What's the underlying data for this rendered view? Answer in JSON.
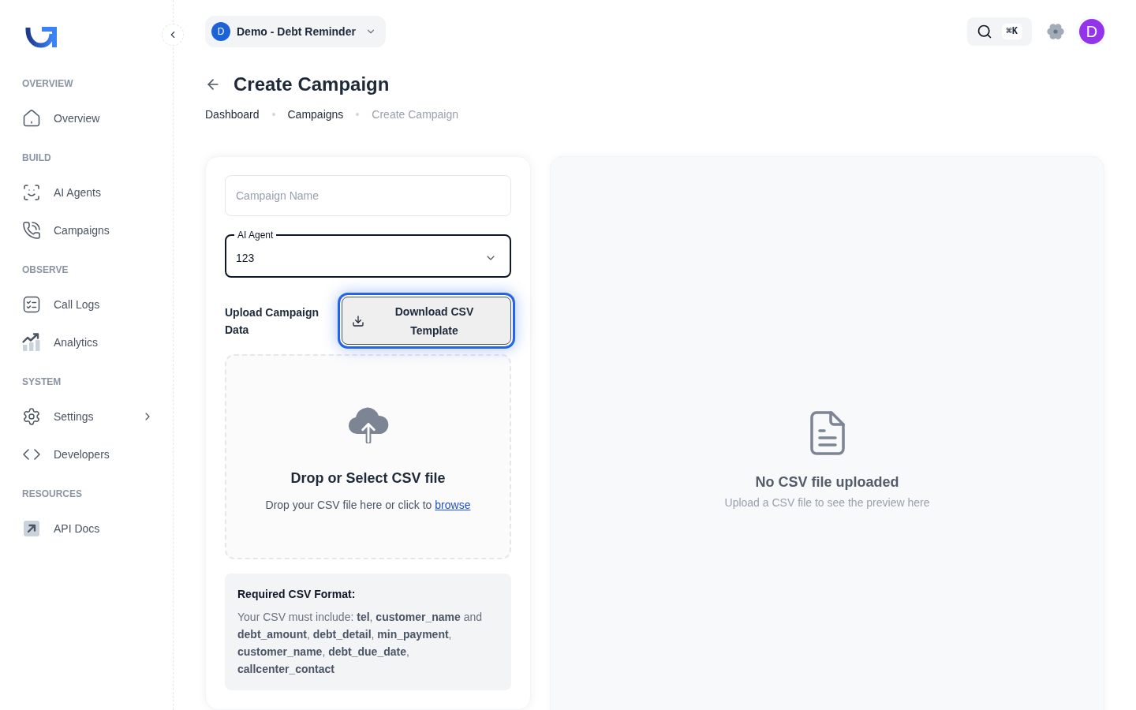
{
  "sidebar": {
    "sections": [
      {
        "heading": "OVERVIEW",
        "items": [
          {
            "label": "Overview",
            "kind": "home",
            "has_submenu": false
          }
        ]
      },
      {
        "heading": "BUILD",
        "items": [
          {
            "label": "AI Agents",
            "kind": "agent",
            "has_submenu": false
          },
          {
            "label": "Campaigns",
            "kind": "phone",
            "has_submenu": false
          }
        ]
      },
      {
        "heading": "OBSERVE",
        "items": [
          {
            "label": "Call Logs",
            "kind": "checklist",
            "has_submenu": false
          },
          {
            "label": "Analytics",
            "kind": "chart",
            "has_submenu": false
          }
        ]
      },
      {
        "heading": "SYSTEM",
        "items": [
          {
            "label": "Settings",
            "kind": "settings",
            "has_submenu": true
          },
          {
            "label": "Developers",
            "kind": "code",
            "has_submenu": false
          }
        ]
      },
      {
        "heading": "RESOURCES",
        "items": [
          {
            "label": "API Docs",
            "kind": "link",
            "has_submenu": false
          }
        ]
      }
    ]
  },
  "header": {
    "workspace": {
      "initial": "D",
      "name": "Demo - Debt Reminder"
    },
    "search": {
      "shortcut": "⌘K"
    },
    "avatar": {
      "initial": "D"
    }
  },
  "page": {
    "title": "Create Campaign",
    "breadcrumbs": [
      {
        "label": "Dashboard",
        "current": false
      },
      {
        "label": "Campaigns",
        "current": false
      },
      {
        "label": "Create Campaign",
        "current": true
      }
    ]
  },
  "form": {
    "campaign_name": {
      "placeholder": "Campaign Name"
    },
    "agent": {
      "label": "AI Agent",
      "value": "123"
    },
    "upload": {
      "label": "Upload Campaign Data",
      "template_button": {
        "label": "Download CSV Template",
        "focused": true
      }
    },
    "dropzone": {
      "title": "Drop or Select CSV file",
      "text": "Drop your CSV file here or click to",
      "link": "browse"
    },
    "format_note": {
      "title": "Required CSV Format:",
      "text": "Your CSV must include: **tel**, **customer_name** and **debt_amount**, **debt_detail**, **min_payment**, **customer_name**, **debt_due_date**, **callcenter_contact**"
    }
  },
  "preview": {
    "title": "No CSV file uploaded",
    "subtitle": "Upload a CSV file to see the preview here"
  }
}
